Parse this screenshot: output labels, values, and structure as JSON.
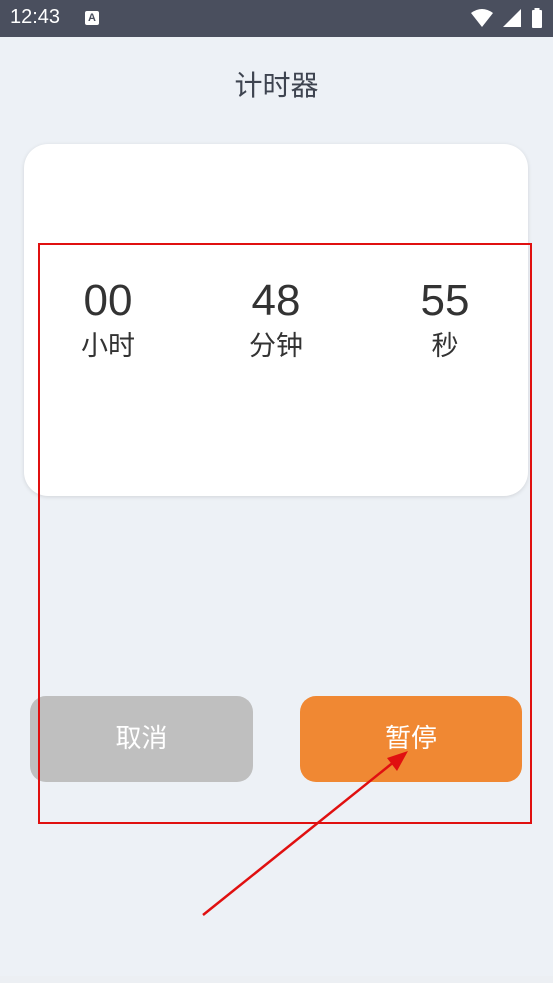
{
  "status_bar": {
    "time": "12:43",
    "notification_icon": "A",
    "icons": [
      "wifi-icon",
      "signal-icon",
      "battery-icon"
    ]
  },
  "page": {
    "title": "计时器"
  },
  "timer": {
    "hours": {
      "value": "00",
      "label": "小时"
    },
    "minutes": {
      "value": "48",
      "label": "分钟"
    },
    "seconds": {
      "value": "55",
      "label": "秒"
    }
  },
  "buttons": {
    "cancel": "取消",
    "pause": "暂停"
  },
  "colors": {
    "background": "#edf1f6",
    "status_bar": "#4a4f5e",
    "cancel_button": "#bfbfbf",
    "pause_button": "#f08833",
    "annotation": "#e01010"
  }
}
